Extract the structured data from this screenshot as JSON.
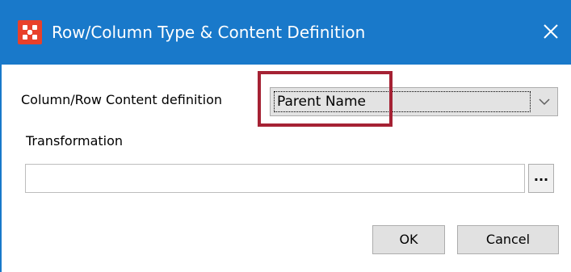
{
  "window": {
    "title": "Row/Column Type & Content Definition",
    "app_icon": "app-logo-icon",
    "close_icon": "close-icon",
    "title_bar_color": "#1979ca"
  },
  "content_definition": {
    "label": "Column/Row Content definition",
    "selected_value": "Parent Name",
    "dropdown_icon": "chevron-down-icon"
  },
  "transformation": {
    "label": "Transformation",
    "value": "",
    "browse_label": "..."
  },
  "buttons": {
    "ok_label": "OK",
    "cancel_label": "Cancel"
  },
  "highlight": {
    "color": "#a52234"
  }
}
